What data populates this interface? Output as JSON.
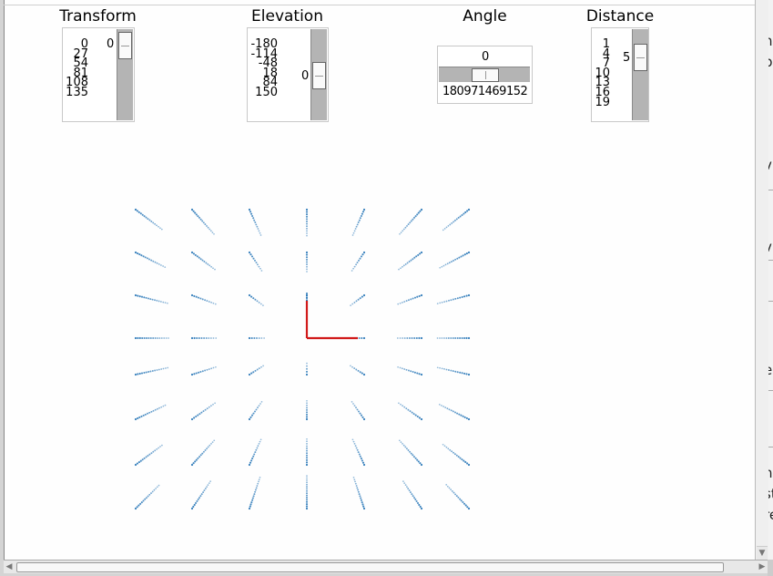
{
  "sliders": {
    "transform": {
      "title": "Transform",
      "ticks": [
        "0",
        "27",
        "54",
        "81",
        "108",
        "135"
      ],
      "value": "0"
    },
    "elevation": {
      "title": "Elevation",
      "ticks": [
        "-180",
        "-114",
        "-48",
        "18",
        "84",
        "150"
      ],
      "value": "0"
    },
    "angle": {
      "title": "Angle",
      "value": "0",
      "ticks_text": "180971469152"
    },
    "distance": {
      "title": "Distance",
      "ticks": [
        "1",
        "4",
        "7",
        "10",
        "13",
        "16",
        "19"
      ],
      "value": "5"
    }
  },
  "right_pane_fragments": [
    "n",
    "p",
    "v",
    "v",
    "e",
    "n",
    "st",
    "re"
  ],
  "colors": {
    "points": "#2a78b8",
    "axis_red": "#d11a1a",
    "slider_track": "#b4b4b4"
  }
}
